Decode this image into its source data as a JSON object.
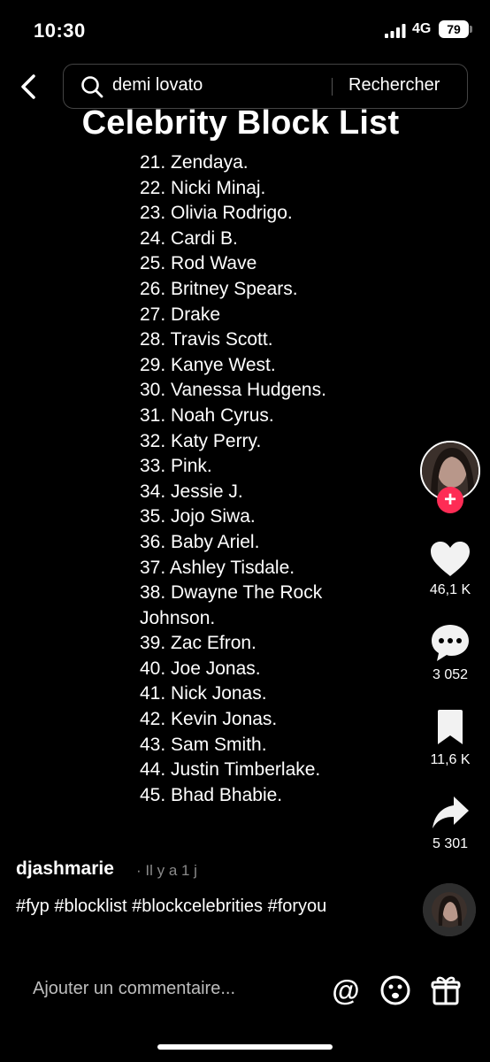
{
  "status_bar": {
    "time": "10:30",
    "network": "4G",
    "battery": "79"
  },
  "search": {
    "query": "demi lovato",
    "button_label": "Rechercher"
  },
  "video": {
    "title": "Celebrity Block List",
    "list": [
      "21. Zendaya.",
      "22. Nicki Minaj.",
      "23. Olivia Rodrigo.",
      "24. Cardi B.",
      "25. Rod Wave",
      "26. Britney Spears.",
      "27. Drake",
      "28. Travis Scott.",
      "29. Kanye West.",
      "30. Vanessa Hudgens.",
      "31. Noah Cyrus.",
      "32. Katy Perry.",
      "33. Pink.",
      "34. Jessie J.",
      "35. Jojo Siwa.",
      "36. Baby Ariel.",
      "37. Ashley Tisdale.",
      "38. Dwayne The Rock",
      "Johnson.",
      "39. Zac Efron.",
      "40. Joe Jonas.",
      "41. Nick Jonas.",
      "42. Kevin Jonas.",
      "43. Sam Smith.",
      "44. Justin Timberlake.",
      "45. Bhad Bhabie."
    ]
  },
  "actions": {
    "follow_symbol": "+",
    "likes": "46,1 K",
    "comments": "3 052",
    "saves": "11,6 K",
    "shares": "5 301"
  },
  "post": {
    "username": "djashmarie",
    "timestamp": "· Il y a 1 j",
    "caption": "#fyp #blocklist #blockcelebrities #foryou"
  },
  "comment_bar": {
    "placeholder": "Ajouter un commentaire...",
    "mention_symbol": "@"
  },
  "colors": {
    "background": "#000000",
    "follow_accent": "#fe2c55",
    "muted_text": "#8a8a8a"
  },
  "icons": [
    "back-chevron-icon",
    "search-icon",
    "heart-icon",
    "comment-icon",
    "bookmark-icon",
    "share-icon",
    "emoji-icon",
    "gift-icon"
  ]
}
